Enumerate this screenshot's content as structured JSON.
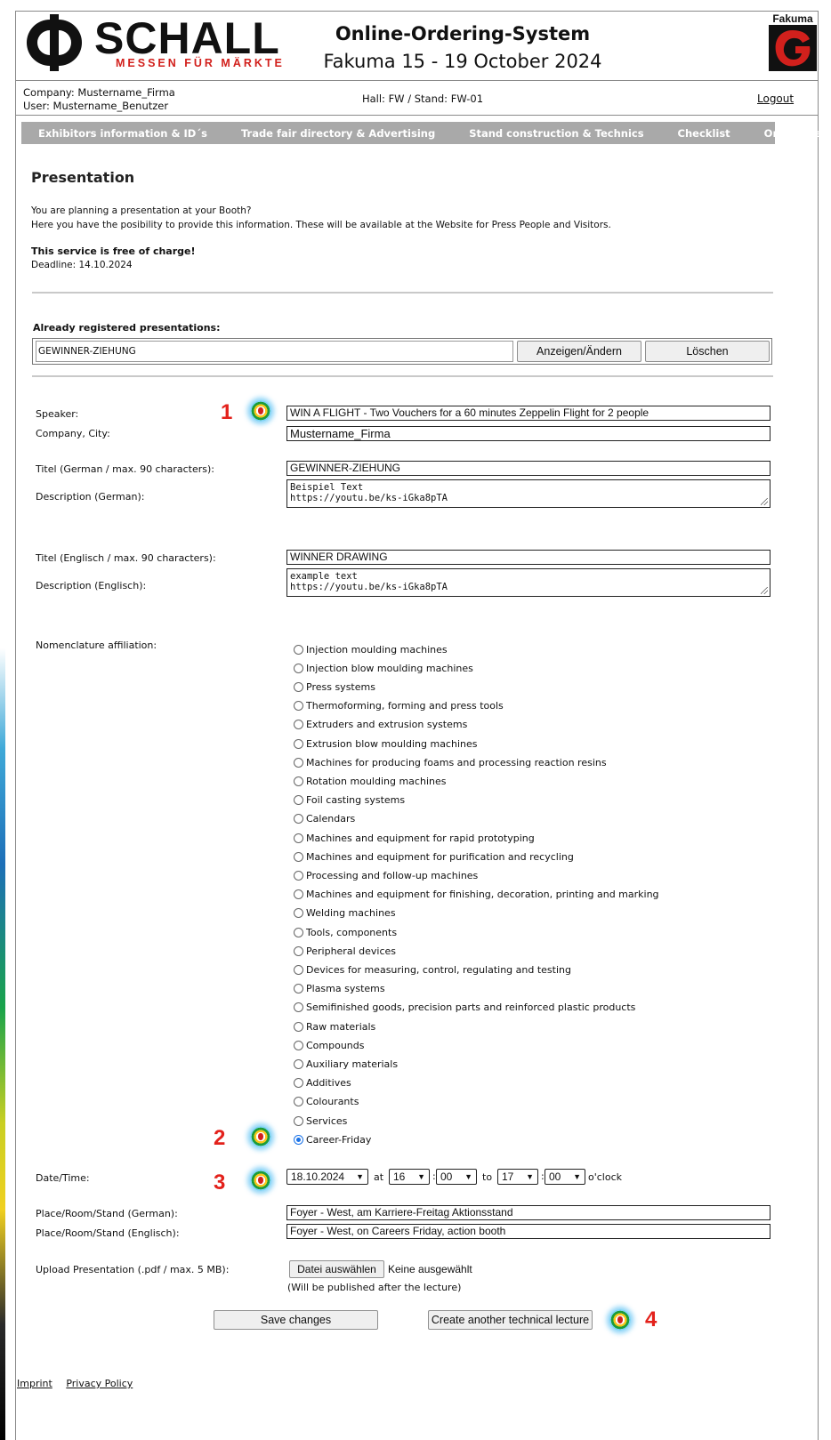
{
  "header": {
    "logo_word": "SCHALL",
    "logo_tagline": "MESSEN FÜR MÄRKTE",
    "system_title": "Online-Ordering-System",
    "event": "Fakuma 15 - 19 October 2024",
    "fakuma_logo_text": "Fakuma",
    "company": "Company: Mustername_Firma",
    "user": "User: Mustername_Benutzer",
    "hall_stand": "Hall: FW / Stand: FW-01",
    "logout": "Logout"
  },
  "nav": {
    "items": [
      "Exhibitors information & ID´s",
      "Trade fair directory & Advertising",
      "Stand construction & Technics",
      "Checklist",
      "Order overview"
    ]
  },
  "page": {
    "title": "Presentation",
    "intro_line1": "You are planning a presentation at your Booth?",
    "intro_line2": "Here you have the posibility to provide this information. These will be available at the Website for Press People and Visitors.",
    "free_notice": "This service is free of charge!",
    "deadline": "Deadline: 14.10.2024"
  },
  "registered": {
    "heading": "Already registered presentations:",
    "name": "GEWINNER-ZIEHUNG",
    "show_button": "Anzeigen/Ändern",
    "delete_button": "Löschen"
  },
  "form": {
    "speaker_label": "Speaker:",
    "speaker_value": "WIN A FLIGHT -  Two Vouchers for a 60 minutes Zeppelin Flight for 2 people",
    "company_label": "Company, City:",
    "company_value": "Mustername_Firma",
    "title_de_label": "Titel (German / max. 90 characters):",
    "title_de_value": "GEWINNER-ZIEHUNG",
    "desc_de_label": "Description (German):",
    "desc_de_line1": "Beispiel Text",
    "desc_de_line2": "https://youtu.be/ks-iGka8pTA",
    "title_en_label": "Titel (Englisch / max. 90 characters):",
    "title_en_value": "WINNER DRAWING",
    "desc_en_label": "Description (Englisch):",
    "desc_en_line1": "example text",
    "desc_en_line2": "https://youtu.be/ks-iGka8pTA",
    "nomenclature_label": "Nomenclature affiliation:",
    "nomenclature_selected": "Career-Friday",
    "nomenclature_options": [
      "Injection moulding machines",
      "Injection blow moulding machines",
      "Press systems",
      "Thermoforming, forming and press tools",
      "Extruders and extrusion systems",
      "Extrusion blow moulding machines",
      "Machines for producing foams and processing reaction resins",
      "Rotation moulding machines",
      "Foil casting systems",
      "Calendars",
      "Machines and equipment for rapid prototyping",
      "Machines and equipment for purification and recycling",
      "Processing and follow-up machines",
      "Machines and equipment for finishing, decoration, printing and marking",
      "Welding machines",
      "Tools, components",
      "Peripheral devices",
      "Devices for measuring, control, regulating and testing",
      "Plasma systems",
      "Semifinished goods, precision parts and reinforced plastic products",
      "Raw materials",
      "Compounds",
      "Auxiliary materials",
      "Additives",
      "Colourants",
      "Services",
      "Career-Friday"
    ],
    "datetime_label": "Date/Time:",
    "date_value": "18.10.2024",
    "at_text": "at",
    "from_hour": "16",
    "from_min": "00",
    "to_text": "to",
    "to_hour": "17",
    "to_min": "00",
    "oclock_text": "o'clock",
    "place_de_label": "Place/Room/Stand (German):",
    "place_de_value": "Foyer - West,  am Karriere-Freitag Aktionsstand",
    "place_en_label": "Place/Room/Stand (Englisch):",
    "place_en_value": "Foyer - West, on Careers Friday, action booth",
    "upload_label": "Upload Presentation (.pdf / max. 5 MB):",
    "file_button": "Datei auswählen",
    "file_status": "Keine ausgewählt",
    "upload_note": "(Will be published after the lecture)",
    "save_button": "Save changes",
    "create_button": "Create another technical lecture"
  },
  "markers": [
    "1",
    "2",
    "3",
    "4"
  ],
  "footer": {
    "imprint": "Imprint",
    "privacy": "Privacy Policy"
  },
  "colors": {
    "brand_red": "#d2201c",
    "nav_bg": "#a9a9a9",
    "marker_number": "#e3211b",
    "radio_selected": "#1a73e8"
  }
}
